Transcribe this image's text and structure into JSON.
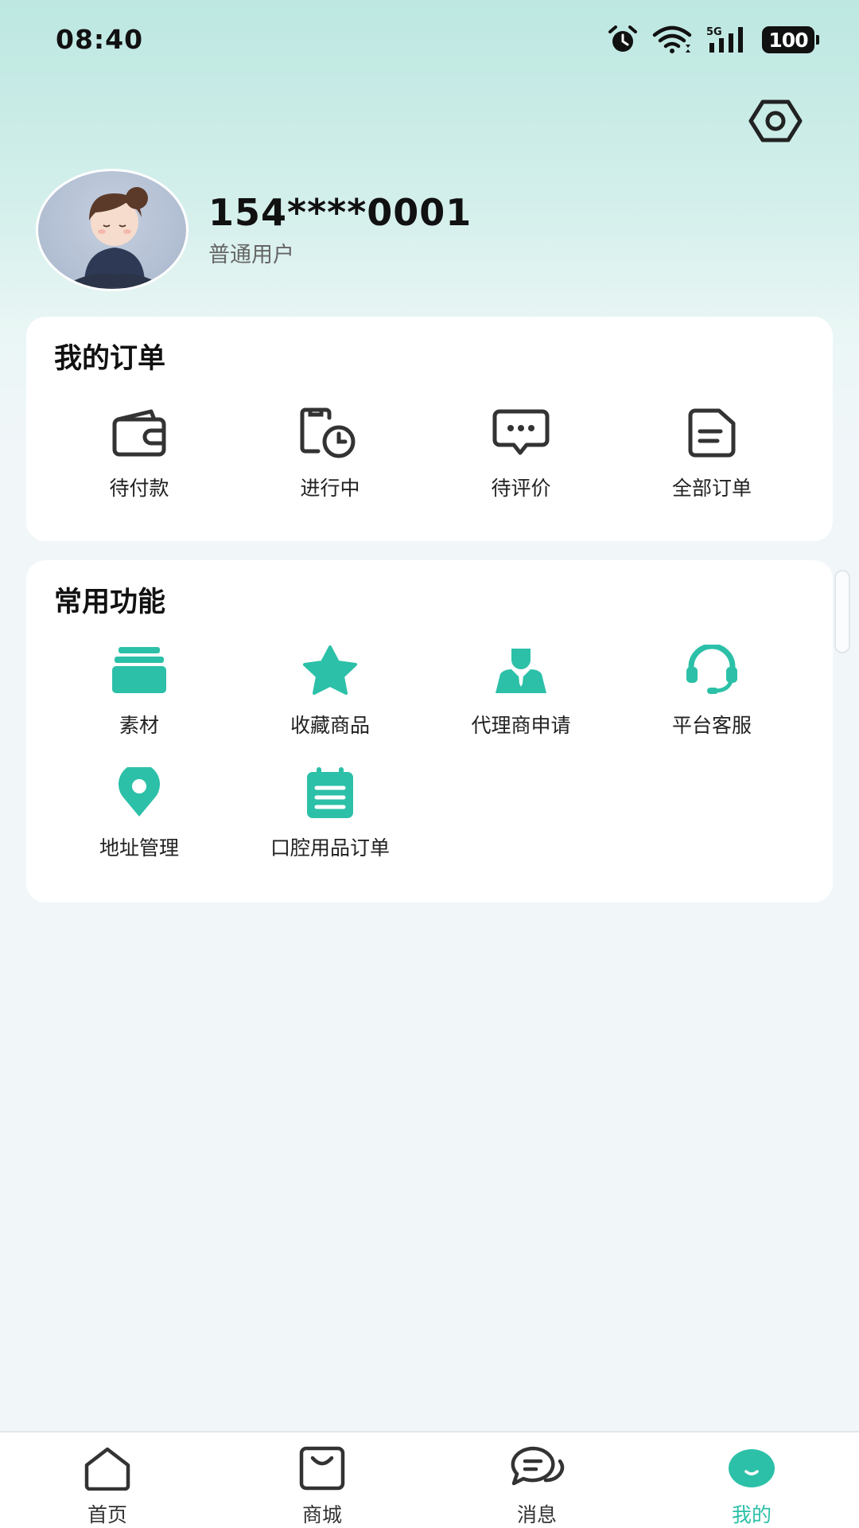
{
  "status_bar": {
    "time": "08:40",
    "battery": "100",
    "network": "5G",
    "icons": [
      "alarm-icon",
      "wifi-icon",
      "signal-icon",
      "battery-icon"
    ]
  },
  "header": {
    "settings_icon": "settings-hex-icon"
  },
  "profile": {
    "phone": "154****0001",
    "level": "普通用户"
  },
  "orders": {
    "title": "我的订单",
    "items": [
      {
        "label": "待付款",
        "icon": "wallet-icon"
      },
      {
        "label": "进行中",
        "icon": "clock-clipboard-icon"
      },
      {
        "label": "待评价",
        "icon": "chat-bubble-icon"
      },
      {
        "label": "全部订单",
        "icon": "document-icon"
      }
    ]
  },
  "functions": {
    "title": "常用功能",
    "items": [
      {
        "label": "素材",
        "icon": "stack-icon"
      },
      {
        "label": "收藏商品",
        "icon": "star-icon"
      },
      {
        "label": "代理商申请",
        "icon": "agent-icon"
      },
      {
        "label": "平台客服",
        "icon": "headset-icon"
      },
      {
        "label": "地址管理",
        "icon": "location-pin-icon"
      },
      {
        "label": "口腔用品订单",
        "icon": "clipboard-list-icon"
      }
    ]
  },
  "bottom_nav": {
    "items": [
      {
        "label": "首页",
        "icon": "home-icon"
      },
      {
        "label": "商城",
        "icon": "shopping-bag-icon"
      },
      {
        "label": "消息",
        "icon": "message-icon"
      },
      {
        "label": "我的",
        "icon": "profile-smile-icon",
        "active": true
      }
    ]
  },
  "colors": {
    "accent": "#2cc0a8",
    "dark_icon": "#333333",
    "header_gradient_top": "#bde7e1"
  }
}
